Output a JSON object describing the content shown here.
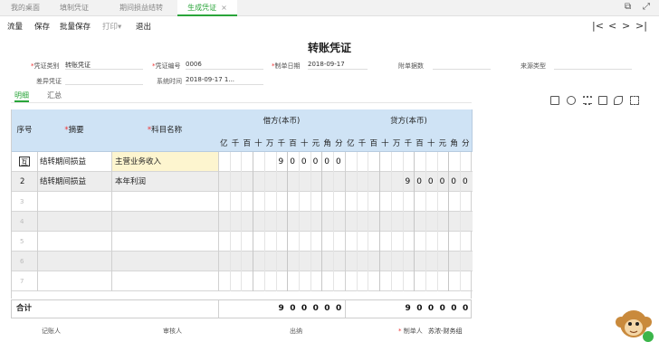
{
  "tabs": [
    {
      "label": "我的桌面",
      "active": false
    },
    {
      "label": "填制凭证",
      "active": false
    },
    {
      "label": "期间损益结转",
      "active": false
    },
    {
      "label": "生成凭证",
      "active": true,
      "close": "×"
    }
  ],
  "toolbar": {
    "items": [
      "流量",
      "保存",
      "批量保存",
      "打印▾",
      "退出"
    ],
    "nav_first": "|<",
    "nav_prev": "<",
    "nav_next": ">",
    "nav_last": ">|"
  },
  "voucher": {
    "title": "转账凭证",
    "fields": {
      "type_label": "凭证类别",
      "type_value": "转账凭证",
      "number_label": "凭证编号",
      "number_value": "0006",
      "date_label": "制单日期",
      "date_value": "2018-09-17",
      "attach_label": "附单据数",
      "source_label": "来源类型",
      "diff_label": "差异凭证",
      "systime_label": "系统时间",
      "systime_value": "2018-09-17 1..."
    },
    "subtabs": [
      "明细",
      "汇总"
    ],
    "icons": [
      "print-icon",
      "lock-icon",
      "list-icon",
      "table-icon",
      "link-icon",
      "fullscreen-icon"
    ]
  },
  "table": {
    "headers": {
      "seq": "序号",
      "summary": "摘要",
      "account": "科目名称",
      "debit": "借方(本币)",
      "credit": "贷方(本币)"
    },
    "digit_units": [
      "亿",
      "千",
      "百",
      "十",
      "万",
      "千",
      "百",
      "十",
      "元",
      "角",
      "分"
    ],
    "rows": [
      {
        "seq": "",
        "summary": "结转期间损益",
        "account": "主营业务收入",
        "debit": "900000",
        "credit": ""
      },
      {
        "seq": "2",
        "summary": "结转期间损益",
        "account": "本年利润",
        "debit": "",
        "credit": "900000"
      },
      {
        "seq": "3",
        "summary": "",
        "account": "",
        "debit": "",
        "credit": ""
      },
      {
        "seq": "4",
        "summary": "",
        "account": "",
        "debit": "",
        "credit": ""
      },
      {
        "seq": "5",
        "summary": "",
        "account": "",
        "debit": "",
        "credit": ""
      },
      {
        "seq": "6",
        "summary": "",
        "account": "",
        "debit": "",
        "credit": ""
      },
      {
        "seq": "7",
        "summary": "",
        "account": "",
        "debit": "",
        "credit": ""
      }
    ],
    "total_label": "合计",
    "total_debit": "900000",
    "total_credit": "900000"
  },
  "footer": {
    "bookkeeper": "记账人",
    "auditor": "审核人",
    "cashier": "出纳",
    "maker_label": "制单人",
    "maker_value": "苏浓-财务组"
  },
  "colors": {
    "accent": "#2aa53a",
    "header_bg": "#cfe3f5",
    "row_highlight": "#fdf5cf"
  }
}
